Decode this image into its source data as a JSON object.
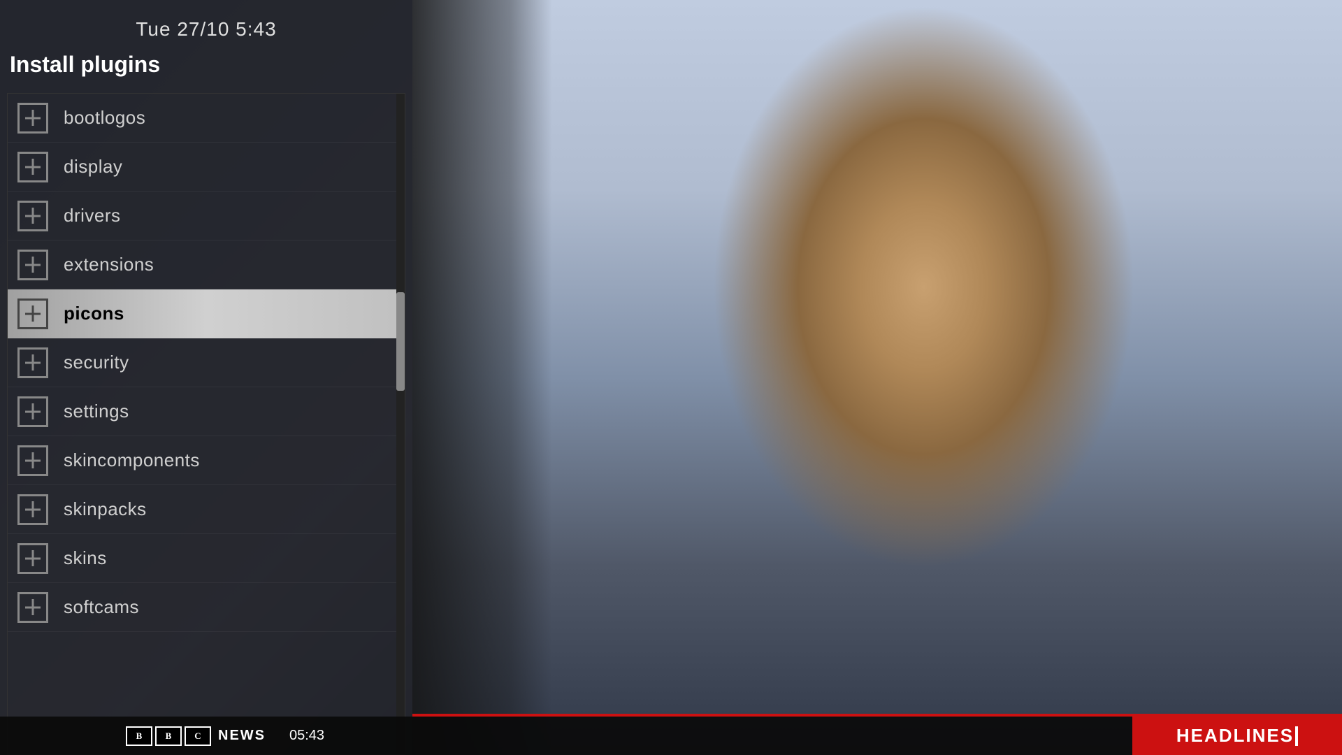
{
  "header": {
    "datetime": "Tue 27/10  5:43",
    "title": "Install plugins"
  },
  "plugins": {
    "items": [
      {
        "id": "bootlogos",
        "label": "bootlogos",
        "selected": false
      },
      {
        "id": "display",
        "label": "display",
        "selected": false
      },
      {
        "id": "drivers",
        "label": "drivers",
        "selected": false
      },
      {
        "id": "extensions",
        "label": "extensions",
        "selected": false
      },
      {
        "id": "picons",
        "label": "picons",
        "selected": true
      },
      {
        "id": "security",
        "label": "security",
        "selected": false
      },
      {
        "id": "settings",
        "label": "settings",
        "selected": false
      },
      {
        "id": "skincomponents",
        "label": "skincomponents",
        "selected": false
      },
      {
        "id": "skinpacks",
        "label": "skinpacks",
        "selected": false
      },
      {
        "id": "skins",
        "label": "skins",
        "selected": false
      },
      {
        "id": "softcams",
        "label": "softcams",
        "selected": false
      }
    ]
  },
  "bottom_bar": {
    "bbc_b": "B",
    "bbc_b2": "B",
    "bbc_c": "C",
    "news_label": "NEWS",
    "time": "05:43"
  },
  "headlines": {
    "label": "HEADLINES"
  },
  "colors": {
    "selected_bg_start": "#a0a0a0",
    "selected_bg_end": "#d0d0d0",
    "headlines_bg": "#cc1111",
    "panel_bg": "rgba(15,15,20,0.88)"
  }
}
